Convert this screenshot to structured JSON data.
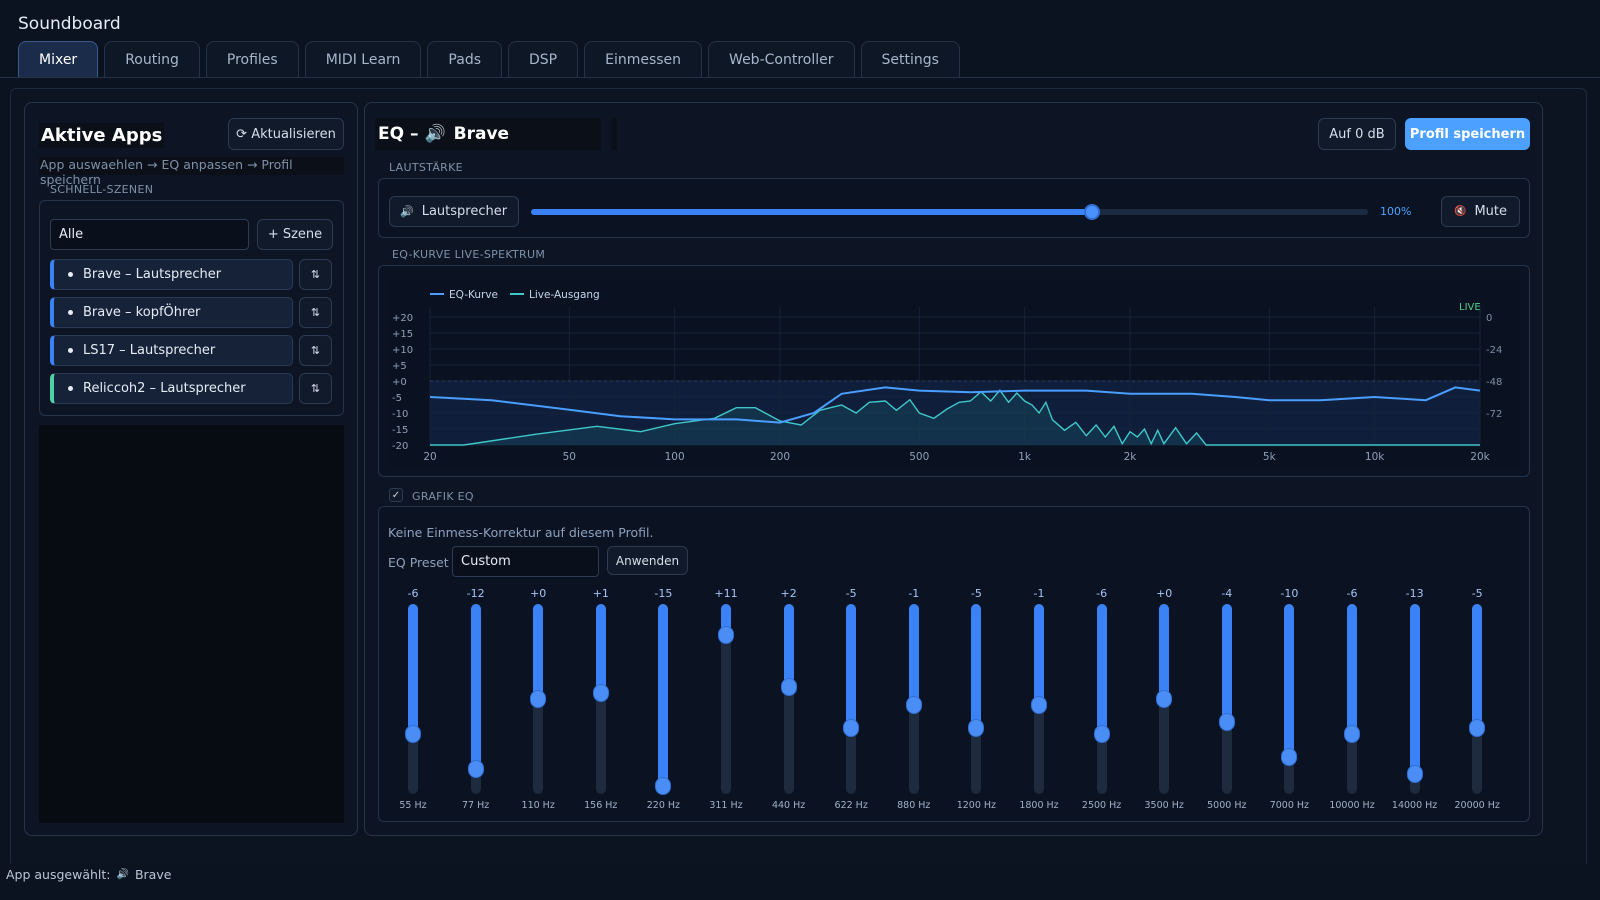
{
  "app": {
    "title": "Soundboard"
  },
  "tabs": [
    {
      "label": "Mixer",
      "active": true
    },
    {
      "label": "Routing"
    },
    {
      "label": "Profiles"
    },
    {
      "label": "MIDI Learn"
    },
    {
      "label": "Pads"
    },
    {
      "label": "DSP"
    },
    {
      "label": "Einmessen"
    },
    {
      "label": "Web-Controller"
    },
    {
      "label": "Settings"
    }
  ],
  "left": {
    "title": "Aktive Apps",
    "refresh_label": "⟳ Aktualisieren",
    "hint": "App auswaehlen → EQ anpassen → Profil speichern",
    "scenes_label": "SCHNELL-SZENEN",
    "scene_filter": "Alle",
    "add_scene_label": "+ Szene",
    "scenes": [
      {
        "label": "Brave – Lautsprecher"
      },
      {
        "label": "Brave – kopfÖhrer"
      },
      {
        "label": "LS17 – Lautsprecher"
      },
      {
        "label": "Reliccoh2 – Lautsprecher"
      }
    ],
    "scene_action_glyph": "⇅"
  },
  "right": {
    "eq_prefix": "EQ –",
    "speaker_glyph": "🔊",
    "app_name": "Brave",
    "zero_label": "Auf 0 dB",
    "save_label": "Profil speichern",
    "volume_label": "LAUTSTÄRKE",
    "output_label": "Lautsprecher",
    "volume_percent": 67,
    "volume_text": "100%",
    "mute_glyph": "🔇",
    "mute_label": "Mute",
    "curve_label": "EQ-KURVE  LIVE-SPEKTRUM",
    "legend": [
      {
        "label": "EQ-Kurve",
        "color": "#4a9eff"
      },
      {
        "label": "Live-Ausgang",
        "color": "#3fc8c8"
      }
    ],
    "live_label": "LIVE",
    "graphic_eq_label": "GRAFIK EQ",
    "graphic_eq_enabled": true,
    "note": "Keine Einmess-Korrektur auf diesem Profil.",
    "preset_label": "EQ Preset",
    "preset_value": "Custom",
    "apply_label": "Anwenden"
  },
  "chart_data": {
    "type": "line",
    "x_scale": "log",
    "x_ticks": [
      20,
      50,
      100,
      200,
      500,
      1000,
      2000,
      5000,
      10000,
      20000
    ],
    "x_tick_labels": [
      "20",
      "50",
      "100",
      "200",
      "500",
      "1k",
      "2k",
      "5k",
      "10k",
      "20k"
    ],
    "y_ticks_left": [
      "+20",
      "+15",
      "+10",
      "+5",
      "+0",
      "-5",
      "-10",
      "-15",
      "-20"
    ],
    "y_left_range": [
      -20,
      20
    ],
    "y_ticks_right": [
      "0",
      "-24",
      "-48",
      "-72"
    ],
    "y_right_range": [
      -96,
      0
    ],
    "grid": true,
    "legend_position": "top-left",
    "series": [
      {
        "name": "EQ-Kurve",
        "x": [
          20,
          30,
          50,
          70,
          100,
          150,
          200,
          250,
          300,
          400,
          500,
          700,
          1000,
          1500,
          2000,
          3000,
          4000,
          5000,
          7000,
          10000,
          14000,
          17000,
          20000
        ],
        "y": [
          -5,
          -6,
          -9,
          -11,
          -12,
          -12,
          -13,
          -10,
          -4,
          -2,
          -3,
          -3.5,
          -3,
          -3,
          -4,
          -4,
          -5,
          -6,
          -6,
          -5,
          -6,
          -2,
          -3
        ]
      },
      {
        "name": "Live-Ausgang",
        "x": [
          20,
          25,
          40,
          60,
          80,
          100,
          130,
          150,
          170,
          200,
          230,
          260,
          300,
          330,
          360,
          400,
          430,
          470,
          500,
          550,
          600,
          650,
          700,
          750,
          800,
          850,
          900,
          950,
          1000,
          1050,
          1100,
          1150,
          1200,
          1300,
          1400,
          1500,
          1600,
          1700,
          1800,
          1900,
          2000,
          2100,
          2200,
          2300,
          2400,
          2500,
          2700,
          2900,
          3100,
          3300,
          3500,
          3800,
          4100,
          4500,
          5000,
          7000,
          10000,
          15000,
          20000
        ],
        "y": [
          -96,
          -96,
          -88,
          -82,
          -86,
          -80,
          -76,
          -68,
          -68,
          -78,
          -81,
          -70,
          -66,
          -72,
          -64,
          -63,
          -70,
          -62,
          -72,
          -76,
          -69,
          -64,
          -63,
          -56,
          -63,
          -55,
          -64,
          -57,
          -63,
          -66,
          -72,
          -64,
          -77,
          -85,
          -79,
          -89,
          -81,
          -90,
          -82,
          -95,
          -86,
          -90,
          -84,
          -95,
          -85,
          -95,
          -83,
          -95,
          -87,
          -96,
          -96,
          -96,
          -96,
          -96,
          -96,
          -96,
          -96,
          -96,
          -96
        ]
      }
    ]
  },
  "bands": [
    {
      "freq": "55 Hz",
      "value": -6
    },
    {
      "freq": "77 Hz",
      "value": -12
    },
    {
      "freq": "110 Hz",
      "value": 0
    },
    {
      "freq": "156 Hz",
      "value": 1
    },
    {
      "freq": "220 Hz",
      "value": -15
    },
    {
      "freq": "311 Hz",
      "value": 11
    },
    {
      "freq": "440 Hz",
      "value": 2
    },
    {
      "freq": "622 Hz",
      "value": -5
    },
    {
      "freq": "880 Hz",
      "value": -1
    },
    {
      "freq": "1200 Hz",
      "value": -5
    },
    {
      "freq": "1800 Hz",
      "value": -1
    },
    {
      "freq": "2500 Hz",
      "value": -6
    },
    {
      "freq": "3500 Hz",
      "value": 0
    },
    {
      "freq": "5000 Hz",
      "value": -4
    },
    {
      "freq": "7000 Hz",
      "value": -10
    },
    {
      "freq": "10000 Hz",
      "value": -6
    },
    {
      "freq": "14000 Hz",
      "value": -13
    },
    {
      "freq": "20000 Hz",
      "value": -5
    }
  ],
  "band_labels": [
    "-6",
    "-12",
    "+0",
    "+1",
    "-15",
    "+11",
    "+2",
    "-5",
    "-1",
    "-5",
    "-1",
    "-6",
    "+0",
    "-4",
    "-10",
    "-6",
    "-13",
    "-5"
  ],
  "status": {
    "prefix": "App ausgewählt:",
    "glyph": "🔊",
    "app": "Brave"
  },
  "colors": {
    "accent": "#3b82f6",
    "save_button": "#4ca0ff",
    "scene_green": "#4fd1a5"
  }
}
